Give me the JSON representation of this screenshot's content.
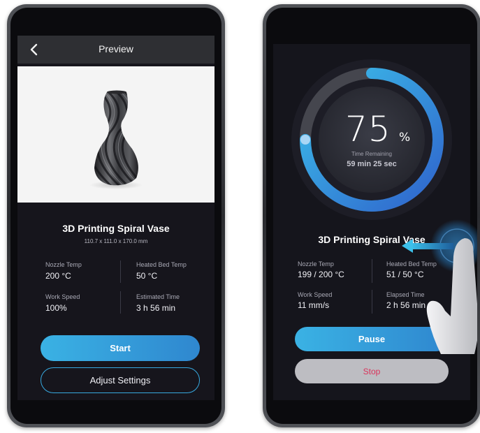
{
  "colors": {
    "accent": "#3ab2e4",
    "accent_dark": "#2f87cf",
    "screen_bg": "#16151c",
    "stop_text": "#d9345b"
  },
  "preview_screen": {
    "title": "Preview",
    "back_icon": "chevron-left-icon",
    "model_name": "3D Printing Spiral Vase",
    "dimensions": "110.7 x 111.0 x 170.0 mm",
    "stats": {
      "nozzle_temp": {
        "label": "Nozzle Temp",
        "value": "200 °C"
      },
      "bed_temp": {
        "label": "Heated Bed Temp",
        "value": "50 °C"
      },
      "work_speed": {
        "label": "Work Speed",
        "value": "100%"
      },
      "estimated_time": {
        "label": "Estimated Time",
        "value": "3 h 56 min"
      }
    },
    "start_label": "Start",
    "adjust_label": "Adjust Settings"
  },
  "printing_screen": {
    "progress": 75,
    "progress_number": "75",
    "progress_unit": "%",
    "time_remaining_label": "Time Remaining",
    "time_remaining_value": "59 min 25 sec",
    "model_name": "3D Printing Spiral Vase",
    "stats": {
      "nozzle_temp": {
        "label": "Nozzle Temp",
        "value": "199 / 200 °C"
      },
      "bed_temp": {
        "label": "Heated Bed Temp",
        "value": "51 / 50 °C"
      },
      "work_speed": {
        "label": "Work Speed",
        "value": "11 mm/s"
      },
      "elapsed_time": {
        "label": "Elapsed Time",
        "value": "2 h 56 min"
      }
    },
    "pause_label": "Pause",
    "stop_label": "Stop",
    "gesture": "swipe-left-hand-icon"
  }
}
